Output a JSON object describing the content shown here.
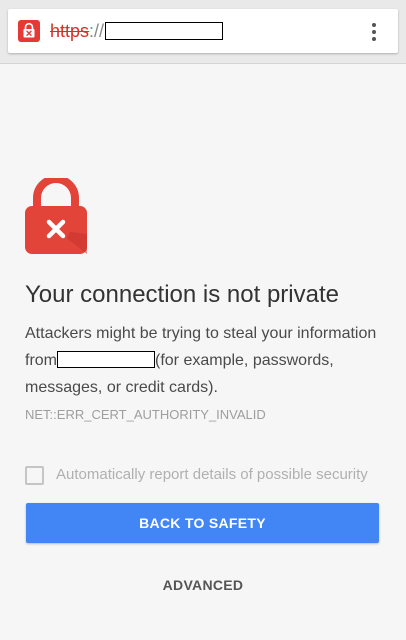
{
  "address_bar": {
    "scheme": "https",
    "separator": "://",
    "redacted_host": ""
  },
  "interstitial": {
    "title": "Your connection is not private",
    "message_before": "Attackers might be trying to steal your information from",
    "message_after": "(for example, passwords, messages, or credit cards).",
    "error_code": "NET::ERR_CERT_AUTHORITY_INVALID",
    "report_checkbox_label": "Automatically report details of possible security",
    "report_checkbox_checked": false,
    "primary_button_label": "BACK TO SAFETY",
    "advanced_button_label": "ADVANCED"
  },
  "icons": {
    "url_lock": "lock-error-icon",
    "big_lock": "lock-error-icon",
    "menu": "more-vert-icon"
  },
  "colors": {
    "danger": "#d93025",
    "primary": "#4285f4",
    "background": "#f6f6f6"
  }
}
